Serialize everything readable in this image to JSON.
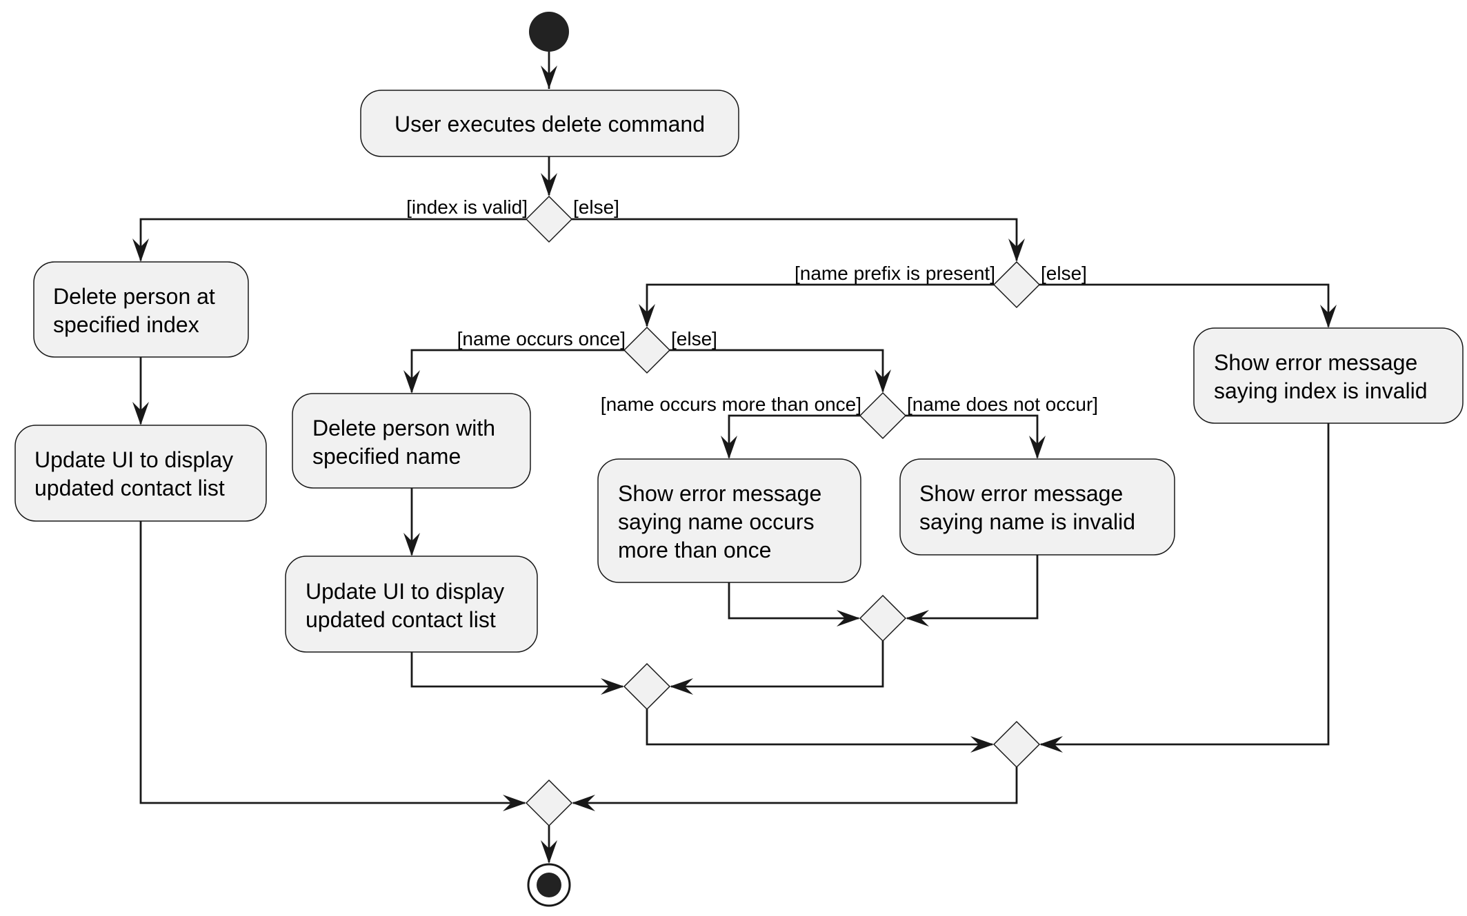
{
  "diagram": {
    "type": "UML activity diagram",
    "colors": {
      "node_fill": "#f1f1f1",
      "stroke": "#181818",
      "start_end_fill": "#222222",
      "background": "#ffffff"
    },
    "activities": {
      "execute": [
        "User executes delete command"
      ],
      "delete_index": [
        "Delete person at",
        "specified index"
      ],
      "update_ui_index": [
        "Update UI to display",
        "updated contact list"
      ],
      "delete_name": [
        "Delete person with",
        "specified name"
      ],
      "update_ui_name": [
        "Update UI to display",
        "updated contact list"
      ],
      "error_multiple": [
        "Show error message",
        "saying name occurs",
        "more than once"
      ],
      "error_name_invalid": [
        "Show error message",
        "saying name is invalid"
      ],
      "error_index_invalid": [
        "Show error message",
        "saying index is invalid"
      ]
    },
    "guards": {
      "index_valid": "[index is valid]",
      "index_else": "[else]",
      "prefix_present": "[name prefix is present]",
      "prefix_else": "[else]",
      "occurs_once": "[name occurs once]",
      "occurs_else": "[else]",
      "occurs_more": "[name occurs more than once]",
      "does_not_occur": "[name does not occur]"
    }
  }
}
